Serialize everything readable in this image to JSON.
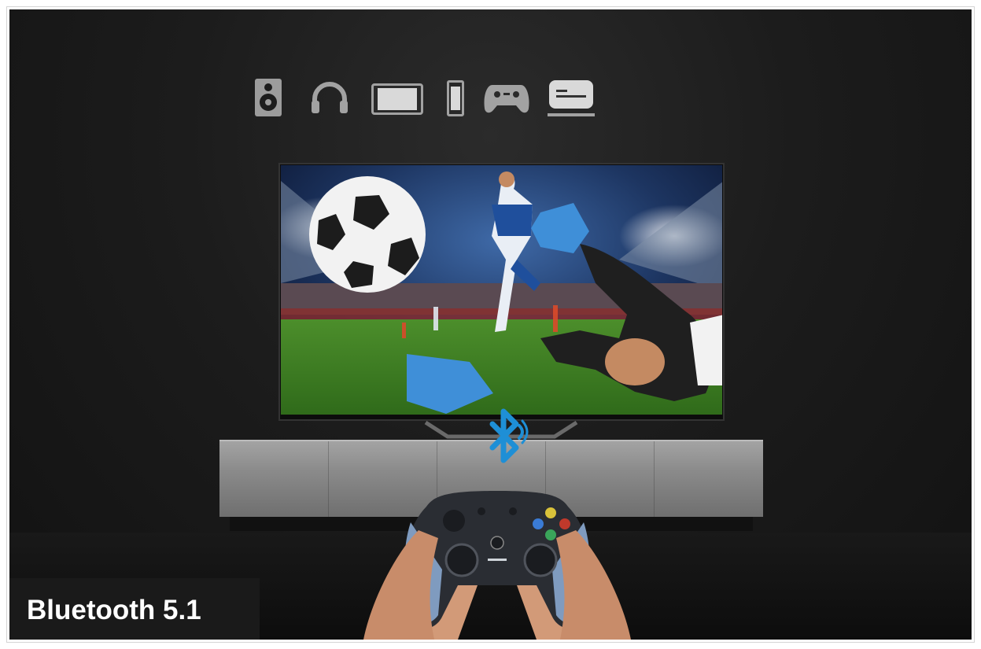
{
  "caption": {
    "text": "Bluetooth 5.1"
  },
  "device_icons": [
    "speaker-icon",
    "headphones-icon",
    "tablet-icon",
    "phone-icon",
    "gamepad-icon",
    "monitor-icon"
  ],
  "colors": {
    "background": "#1c1c1c",
    "icon": "#9c9c9c",
    "bluetooth": "#1e8fd6",
    "caption_bg": "#1a1a1a",
    "caption_text": "#ffffff"
  }
}
